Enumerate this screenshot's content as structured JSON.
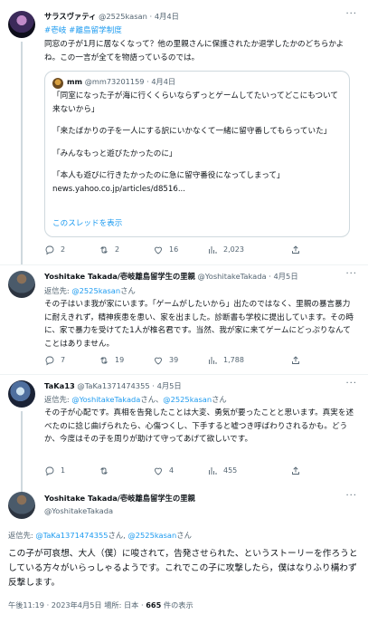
{
  "tweets": [
    {
      "name": "サラスヴァティ",
      "handle": "@2525kasan",
      "sep": "·",
      "date": "4月4日",
      "hashtags": "#壱岐 #離島留学制度",
      "text": "同窓の子が1月に居なくなって？他の里親さんに保護されたか退学したかのどちらかよね。この一言が全てを物語っているのでは。",
      "quote": {
        "name": "mm",
        "handle": "@mm73201159",
        "sep": "·",
        "date": "4月4日",
        "lines": [
          "「同室になった子が海に行くくらいならずっとゲームしてたいってどこにもついて来ないから」",
          "「来たばかりの子を一人にする訳にいかなくて一緒に留守番してもらっていた」",
          "「みんなもっと遊びたかったのに」",
          "「本人も遊びに行きたかったのに急に留守番役になってしまって」"
        ],
        "url": "news.yahoo.co.jp/articles/d8516...",
        "thread_link": "このスレッドを表示"
      },
      "actions": {
        "reply": "2",
        "retweet": "2",
        "like": "16",
        "views": "2,023"
      }
    },
    {
      "name": "Yoshitake Takada/壱岐離島留学生の里親",
      "handle": "@YoshitakeTakada",
      "sep": "·",
      "date": "4月5日",
      "reply_to_label": "返信先:",
      "reply_to": "@2525kasan",
      "reply_suffix": "さん",
      "text": "その子はいま我が家にいます。「ゲームがしたいから」出たのではなく、里親の暴言暴力に耐えきれず，精神疾患を患い、家を出ました。診断書も学校に提出しています。その時に、家で暴力を受けてた1人が椎名君です。当然、我が家に来てゲームにどっぷりなんてことはありません。",
      "actions": {
        "reply": "7",
        "retweet": "19",
        "like": "39",
        "views": "1,788"
      }
    },
    {
      "name": "TaKa13",
      "handle": "@TaKa1371474355",
      "sep": "·",
      "date": "4月5日",
      "reply_to_label": "返信先:",
      "reply_to": "@YoshitakeTakada",
      "reply_mid": "さん、",
      "reply_to2": "@2525kasan",
      "reply_suffix": "さん",
      "text": "その子が心配です。真相を告発したことは大変、勇気が要ったことと思います。真実を述べたのに捻じ曲げられたら、心傷つくし、下手すると嘘つき呼ばわりされるかも。どうか、今度はその子を周りが助けて守ってあげて欲しいです。",
      "actions": {
        "reply": "1",
        "retweet": "",
        "like": "4",
        "views": "455"
      }
    },
    {
      "name": "Yoshitake Takada/壱岐離島留学生の里親",
      "handle": "@YoshitakeTakada",
      "reply_to_label": "返信先:",
      "reply_to": "@TaKa1371474355",
      "reply_mid": "さん,",
      "reply_to2": "@2525kasan",
      "reply_suffix": "さん",
      "text": "この子が可哀想、大人（僕）に唆されて，告発させられた、というストーリーを作ろうとしている方々がいらっしゃるようです。これでこの子に攻撃したら，僕はなりふり構わず反撃します。",
      "time": "午後11:19 · 2023年4月5日",
      "location_label": "場所:",
      "location": "日本",
      "sep": "·",
      "views_count": "665",
      "views_label": "件の表示"
    }
  ],
  "more_label": "···",
  "icons": {
    "reply": "reply-icon",
    "retweet": "retweet-icon",
    "like": "heart-icon",
    "views": "views-chart-icon",
    "share": "share-icon",
    "more": "more-dots-icon"
  },
  "colors": {
    "accent": "#1d9bf0",
    "muted": "#536471",
    "text": "#0f1419",
    "border": "#cfd9de"
  }
}
